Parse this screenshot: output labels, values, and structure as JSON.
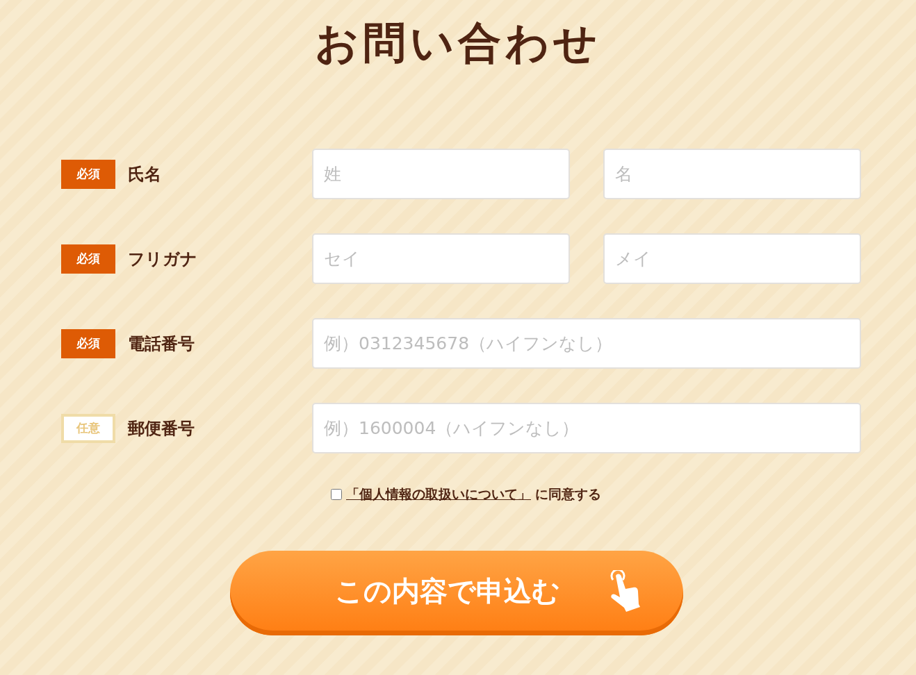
{
  "title": "お問い合わせ",
  "rows": [
    {
      "badge": {
        "kind": "required",
        "label": "必須"
      },
      "label": "氏名",
      "fields": [
        {
          "placeholder": "姓"
        },
        {
          "placeholder": "名"
        }
      ]
    },
    {
      "badge": {
        "kind": "required",
        "label": "必須"
      },
      "label": "フリガナ",
      "fields": [
        {
          "placeholder": "セイ"
        },
        {
          "placeholder": "メイ"
        }
      ]
    },
    {
      "badge": {
        "kind": "required",
        "label": "必須"
      },
      "label": "電話番号",
      "fields": [
        {
          "placeholder": "例）0312345678（ハイフンなし）"
        }
      ]
    },
    {
      "badge": {
        "kind": "optional",
        "label": "任意"
      },
      "label": "郵便番号",
      "fields": [
        {
          "placeholder": "例）1600004（ハイフンなし）"
        }
      ]
    }
  ],
  "agreement": {
    "checked": false,
    "link": "「個人情報の取扱いについて」",
    "text": "に同意する"
  },
  "submit": {
    "label": "この内容で申込む"
  }
}
